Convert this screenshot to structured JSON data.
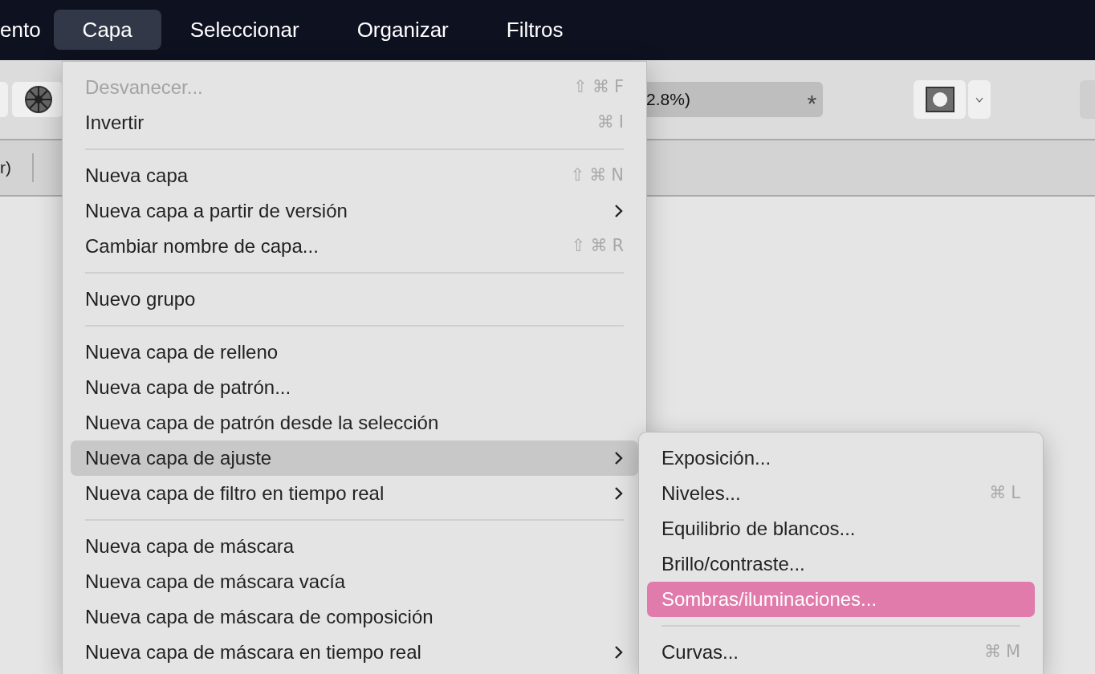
{
  "menubar": [
    {
      "label": "ento",
      "selected": false
    },
    {
      "label": "Capa",
      "selected": true
    },
    {
      "label": "Seleccionar",
      "selected": false
    },
    {
      "label": "Organizar",
      "selected": false
    },
    {
      "label": "Filtros",
      "selected": false
    }
  ],
  "toolbar": {
    "zoom_field": {
      "value": "2.8%)",
      "marker": "*"
    }
  },
  "secondary_bar": {
    "texts": [
      "r)"
    ]
  },
  "menu": {
    "items": [
      {
        "kind": "item",
        "label": "Desvanecer...",
        "shortcut": "⇧⌘F",
        "disabled": true,
        "has_submenu": false,
        "selected": false
      },
      {
        "kind": "item",
        "label": "Invertir",
        "shortcut": "⌘I",
        "disabled": false,
        "has_submenu": false,
        "selected": false
      },
      {
        "kind": "separator"
      },
      {
        "kind": "item",
        "label": "Nueva capa",
        "shortcut": "⇧⌘N",
        "disabled": false,
        "has_submenu": false,
        "selected": false
      },
      {
        "kind": "item",
        "label": "Nueva capa a partir de versión",
        "disabled": false,
        "has_submenu": true,
        "selected": false
      },
      {
        "kind": "item",
        "label": "Cambiar nombre de capa...",
        "shortcut": "⇧⌘R",
        "disabled": false,
        "has_submenu": false,
        "selected": false
      },
      {
        "kind": "separator"
      },
      {
        "kind": "item",
        "label": "Nuevo grupo",
        "disabled": false,
        "has_submenu": false,
        "selected": false
      },
      {
        "kind": "separator"
      },
      {
        "kind": "item",
        "label": "Nueva capa de relleno",
        "disabled": false,
        "has_submenu": false,
        "selected": false
      },
      {
        "kind": "item",
        "label": "Nueva capa de patrón...",
        "disabled": false,
        "has_submenu": false,
        "selected": false
      },
      {
        "kind": "item",
        "label": "Nueva capa de patrón desde la selección",
        "disabled": false,
        "has_submenu": false,
        "selected": false
      },
      {
        "kind": "item",
        "label": "Nueva capa de ajuste",
        "disabled": false,
        "has_submenu": true,
        "selected": true
      },
      {
        "kind": "item",
        "label": "Nueva capa de filtro en tiempo real",
        "disabled": false,
        "has_submenu": true,
        "selected": false
      },
      {
        "kind": "separator"
      },
      {
        "kind": "item",
        "label": "Nueva capa de máscara",
        "disabled": false,
        "has_submenu": false,
        "selected": false
      },
      {
        "kind": "item",
        "label": "Nueva capa de máscara vacía",
        "disabled": false,
        "has_submenu": false,
        "selected": false
      },
      {
        "kind": "item",
        "label": "Nueva capa de máscara de composición",
        "disabled": false,
        "has_submenu": false,
        "selected": false
      },
      {
        "kind": "item",
        "label": "Nueva capa de máscara en tiempo real",
        "disabled": false,
        "has_submenu": true,
        "selected": false
      }
    ]
  },
  "submenu": {
    "items": [
      {
        "kind": "item",
        "label": "Exposición...",
        "disabled": false,
        "has_submenu": false,
        "selected": false
      },
      {
        "kind": "item",
        "label": "Niveles...",
        "shortcut": "⌘L",
        "disabled": false,
        "has_submenu": false,
        "selected": false
      },
      {
        "kind": "item",
        "label": "Equilibrio de blancos...",
        "disabled": false,
        "has_submenu": false,
        "selected": false
      },
      {
        "kind": "item",
        "label": "Brillo/contraste...",
        "disabled": false,
        "has_submenu": false,
        "selected": false
      },
      {
        "kind": "item",
        "label": "Sombras/iluminaciones...",
        "disabled": false,
        "has_submenu": false,
        "selected": true
      },
      {
        "kind": "separator"
      },
      {
        "kind": "item",
        "label": "Curvas...",
        "shortcut": "⌘M",
        "disabled": false,
        "has_submenu": false,
        "selected": false
      }
    ]
  }
}
